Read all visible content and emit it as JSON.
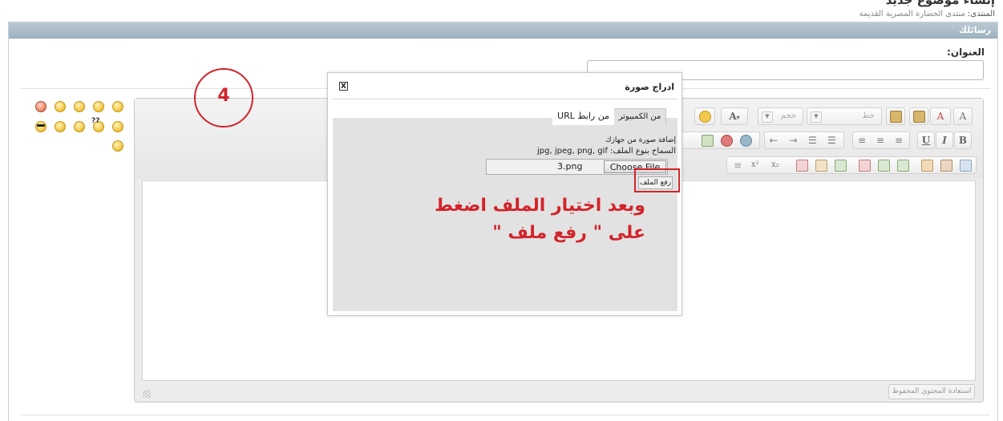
{
  "page": {
    "title": "إنشاء موضوع جديد",
    "breadcrumb_label": "المنتدى:",
    "breadcrumb_forum": "منتدى الحضارة المصرية القديمة"
  },
  "panel": {
    "header": "رسائلك"
  },
  "form": {
    "title_label": "العنوان:",
    "title_value": ""
  },
  "toolbar": {
    "font_placeholder": "خط",
    "size_placeholder": "حجم",
    "font_color_label": "A",
    "remove_format_label": "A",
    "bold_label": "B",
    "italic_label": "I",
    "underline_label": "U",
    "superscript_label": "x²",
    "subscript_label": "x₂"
  },
  "editor": {
    "restore_button": "استعادة المحتوى المحفوظ",
    "content": ""
  },
  "annotation_number": "4",
  "dialog": {
    "title": "ادراج صورة",
    "close_label": "X",
    "tabs": [
      {
        "label": "من الكمبيوتر",
        "active": true
      },
      {
        "label": "من رابط URL",
        "active": false
      }
    ],
    "upload_heading": "إضافة صورة من جهازك",
    "allowed_types": "السماح بنوع الملف: jpg, jpeg, png, gif",
    "file_name": "3.png",
    "choose_button": "Choose File",
    "upload_button": "رفع الملف"
  },
  "instruction": {
    "line1": "وبعد اختيار الملف اضغط",
    "line2": "على \" رفع ملف \""
  },
  "colors": {
    "accent_red": "#d2232a",
    "panel_header": "#a9bdca"
  }
}
